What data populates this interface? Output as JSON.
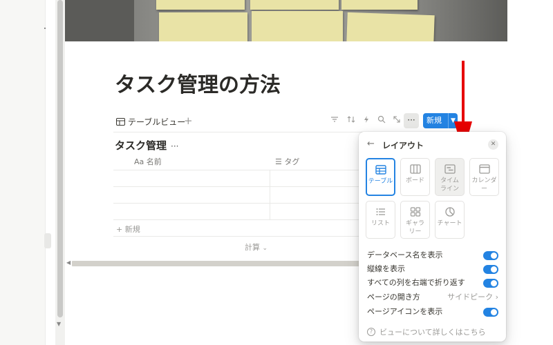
{
  "page": {
    "title": "タスク管理の方法"
  },
  "viewbar": {
    "tab_label": "テーブルビュー",
    "add_label": "+",
    "more_label": "···",
    "new_label": "新規",
    "tools": [
      "filter-icon",
      "sort-icon",
      "automation-icon",
      "search-icon",
      "expand-icon"
    ]
  },
  "database": {
    "title": "タスク管理",
    "more_label": "···",
    "columns": [
      {
        "prefix": "Aa",
        "label": "名前"
      },
      {
        "prefix": "☰",
        "label": "タグ"
      }
    ],
    "add_row_label": "+ 新規",
    "calc_label": "計算"
  },
  "layout_panel": {
    "title": "レイアウト",
    "options": [
      {
        "label": "テーブル",
        "icon": "table-icon",
        "selected": true
      },
      {
        "label": "ボード",
        "icon": "board-icon"
      },
      {
        "label": "タイムライン",
        "icon": "timeline-icon"
      },
      {
        "label": "カレンダー",
        "icon": "calendar-icon"
      },
      {
        "label": "リスト",
        "icon": "list-icon"
      },
      {
        "label": "ギャラリー",
        "icon": "gallery-icon"
      },
      {
        "label": "チャート",
        "icon": "chart-icon"
      }
    ],
    "settings": [
      {
        "label": "データベース名を表示",
        "toggle": true
      },
      {
        "label": "縦線を表示",
        "toggle": true
      },
      {
        "label": "すべての列を右端で折り返す",
        "toggle": true
      },
      {
        "label": "ページの開き方",
        "value": "サイドピーク"
      },
      {
        "label": "ページアイコンを表示",
        "toggle": true
      }
    ],
    "footer": "ビューについて詳しくはこちら"
  },
  "colors": {
    "accent": "#2383e2",
    "annotation_arrow": "#e60000"
  }
}
